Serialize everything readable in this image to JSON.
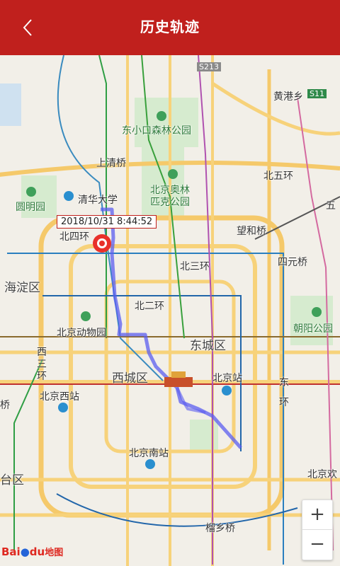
{
  "header": {
    "title": "历史轨迹",
    "back_label": "<"
  },
  "marker": {
    "timestamp": "2018/10/31 8:44:52"
  },
  "zoom": {
    "plus": "+",
    "minus": "−"
  },
  "logo": {
    "part1": "Bai",
    "part2": "du",
    "part3": "地图"
  },
  "map_labels": {
    "s213": "S213",
    "huanggangxiang": "黄港乡",
    "s11": "S11",
    "dongxiaokou": "东小口森林公园",
    "shangqingqiao": "上清桥",
    "beiwuhuan": "北五环",
    "qinghua": "清华大学",
    "aolin": "北京奥林",
    "aolin2": "匹克公园",
    "yuanmingyuan": "圆明园",
    "wu": "五",
    "beisihuan": "北四环",
    "wanghe": "望和桥",
    "haidian": "海淀区",
    "beisanhuan": "北三环",
    "siyuan": "四元桥",
    "beierhuan": "北二环",
    "zoo": "北京动物园",
    "chaoyang": "朝阳公园",
    "dongcheng": "东城区",
    "xisanhuan": "西三环",
    "xicheng": "西城区",
    "bjstation": "北京站",
    "dong": "东",
    "huan": "环",
    "westst": "北京西站",
    "qiao": "桥",
    "southst": "北京南站",
    "taiqu": "台区",
    "bjhuan": "北京欢",
    "liuxiang": "榴乡桥"
  },
  "colors": {
    "header": "#c0201d",
    "track": "#5b5df0"
  }
}
